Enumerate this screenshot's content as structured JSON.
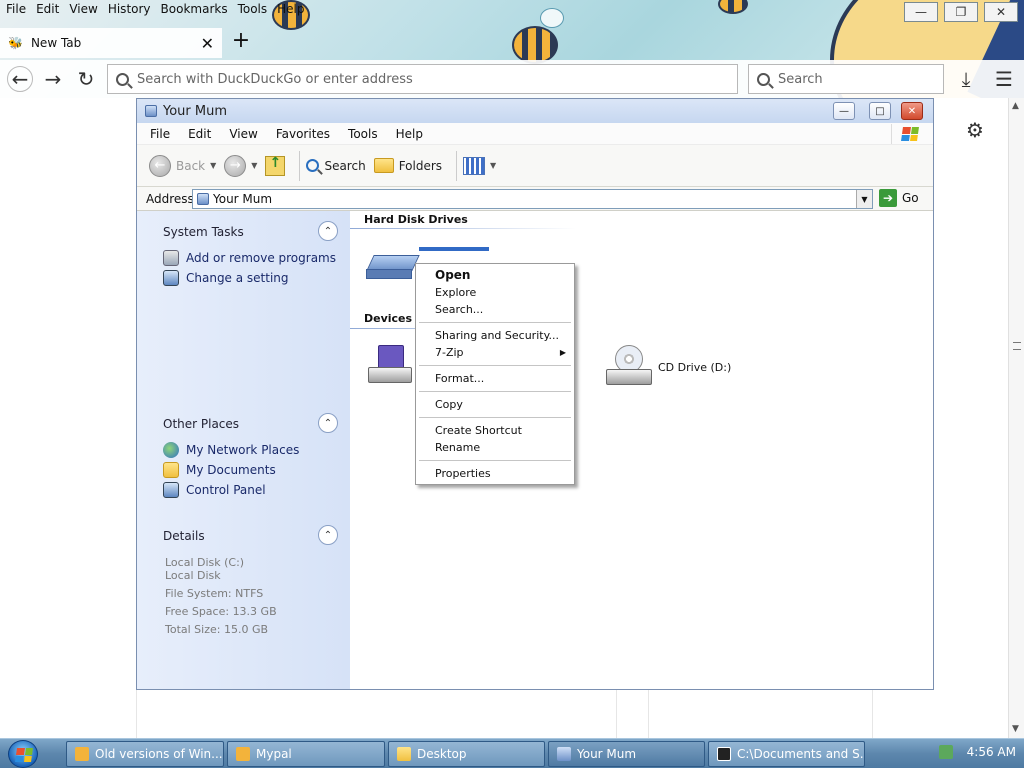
{
  "browser": {
    "menu": [
      "File",
      "Edit",
      "View",
      "History",
      "Bookmarks",
      "Tools",
      "Help"
    ],
    "tab_title": "New Tab",
    "url_placeholder": "Search with DuckDuckGo or enter address",
    "search_placeholder": "Search"
  },
  "explorer": {
    "title": "Your Mum",
    "menu": [
      "File",
      "Edit",
      "View",
      "Favorites",
      "Tools",
      "Help"
    ],
    "toolbar": {
      "back": "Back",
      "search": "Search",
      "folders": "Folders"
    },
    "address_label": "Address",
    "address_value": "Your Mum",
    "go_label": "Go",
    "system_tasks": {
      "title": "System Tasks",
      "items": [
        "Add or remove programs",
        "Change a setting"
      ]
    },
    "other_places": {
      "title": "Other Places",
      "items": [
        "My Network Places",
        "My Documents",
        "Control Panel"
      ]
    },
    "details": {
      "title": "Details",
      "lines": [
        "Local Disk (C:)",
        "Local Disk",
        "File System: NTFS",
        "Free Space: 13.3 GB",
        "Total Size: 15.0 GB"
      ]
    },
    "groups": {
      "hard_disks": "Hard Disk Drives",
      "removable": "Devices w"
    },
    "cd_drive_label": "CD Drive (D:)"
  },
  "context_menu": {
    "items": [
      "Open",
      "Explore",
      "Search...",
      "Sharing and Security...",
      "7-Zip",
      "Format...",
      "Copy",
      "Create Shortcut",
      "Rename",
      "Properties"
    ]
  },
  "taskbar": {
    "buttons": [
      "Old versions of Win...",
      "Mypal",
      "Desktop",
      "Your Mum",
      "C:\\Documents and S..."
    ],
    "clock": "4:56 AM"
  }
}
